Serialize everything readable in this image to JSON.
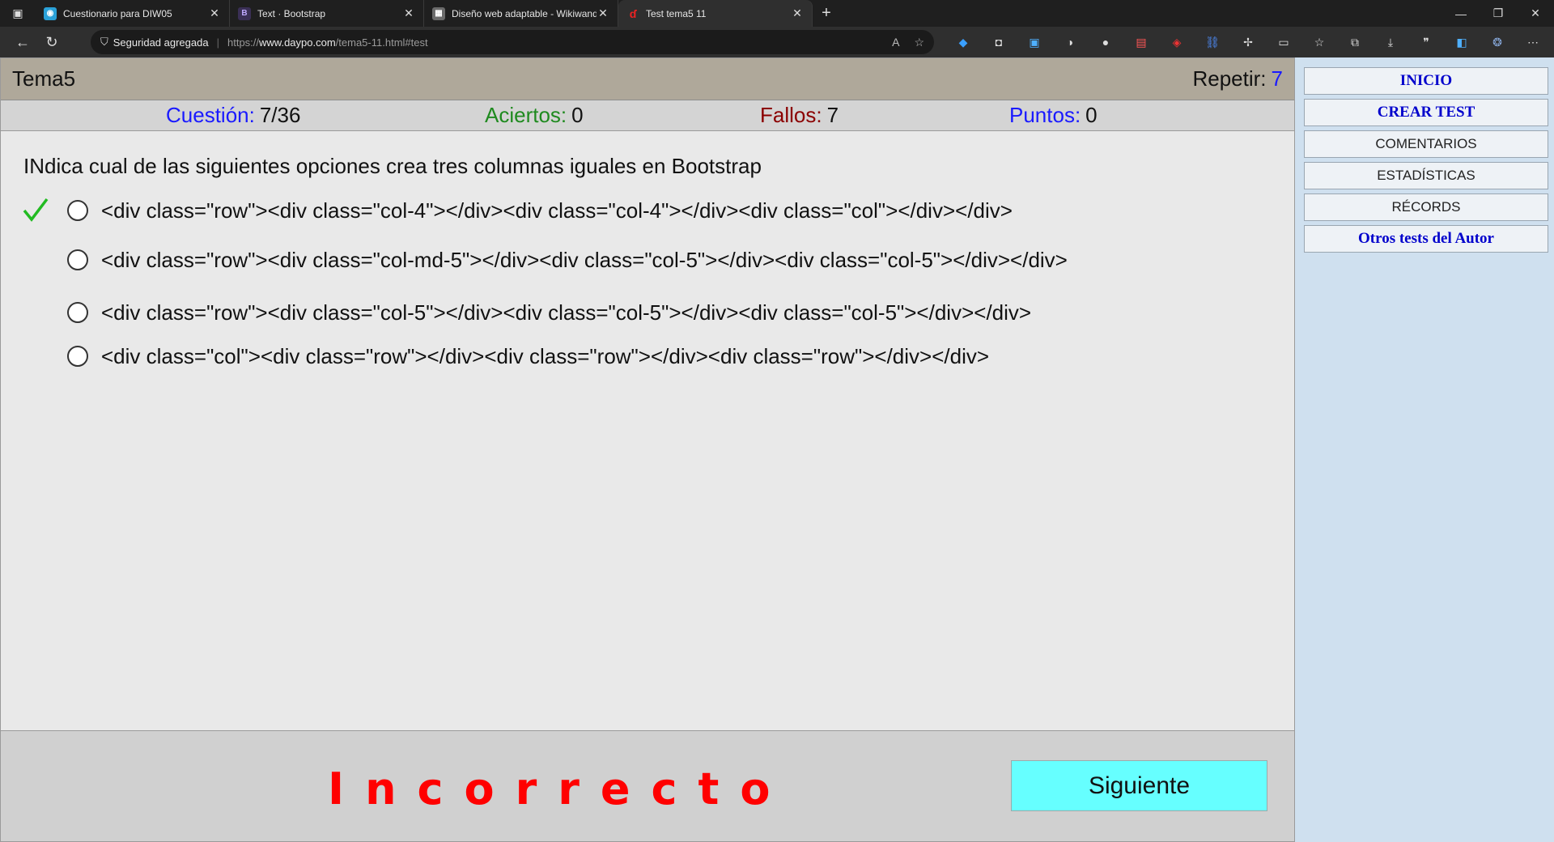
{
  "browser": {
    "tabs": [
      {
        "title": "Cuestionario para DIW05",
        "icon_color": "#2aa1d8",
        "active": false
      },
      {
        "title": "Text · Bootstrap",
        "icon_color": "#7952b3",
        "active": false
      },
      {
        "title": "Diseño web adaptable - Wikiwand",
        "icon_color": "#6b6b6b",
        "active": false
      },
      {
        "title": "Test tema5 11",
        "icon_color": "#d11",
        "active": true
      }
    ],
    "security_label": "Seguridad agregada",
    "url_prefix": "https://",
    "url_host": "www.daypo.com",
    "url_path": "/tema5-11.html#test"
  },
  "quiz": {
    "title": "Tema5",
    "repeat_label": "Repetir:",
    "repeat_value": "7",
    "stats": {
      "question_label": "Cuestión:",
      "question_value": "7/36",
      "correct_label": "Aciertos:",
      "correct_value": "0",
      "wrong_label": "Fallos:",
      "wrong_value": "7",
      "points_label": "Puntos:",
      "points_value": "0"
    },
    "question": "INdica cual de las siguientes opciones crea tres columnas iguales en Bootstrap",
    "options": [
      {
        "text": "<div class=\"row\"><div class=\"col-4\"></div><div class=\"col-4\"></div><div class=\"col\"></div></div>",
        "correct": true
      },
      {
        "text": "<div class=\"row\"><div class=\"col-md-5\"></div><div class=\"col-5\"></div><div class=\"col-5\"></div></div>",
        "correct": false
      },
      {
        "text": "<div class=\"row\"><div class=\"col-5\"></div><div class=\"col-5\"></div><div class=\"col-5\"></div></div>",
        "correct": false
      },
      {
        "text": "<div class=\"col\"><div class=\"row\"></div><div class=\"row\"></div><div class=\"row\"></div></div>",
        "correct": false
      }
    ],
    "verdict": "Incorrecto",
    "next_label": "Siguiente"
  },
  "sidebar": {
    "items": [
      {
        "label": "INICIO",
        "style": "blue"
      },
      {
        "label": "CREAR TEST",
        "style": "blue"
      },
      {
        "label": "COMENTARIOS",
        "style": "plain"
      },
      {
        "label": "ESTADÍSTICAS",
        "style": "plain"
      },
      {
        "label": "RÉCORDS",
        "style": "plain"
      },
      {
        "label": "Otros tests del Autor",
        "style": "blue"
      }
    ]
  },
  "colors": {
    "header_bg": "#afa89a",
    "stat_blue": "#1a1aff",
    "stat_green": "#1f8a1f",
    "stat_red": "#8b0000",
    "verdict_red": "#ff0000",
    "next_button_bg": "#66ffff",
    "check_green": "#22bb22"
  }
}
